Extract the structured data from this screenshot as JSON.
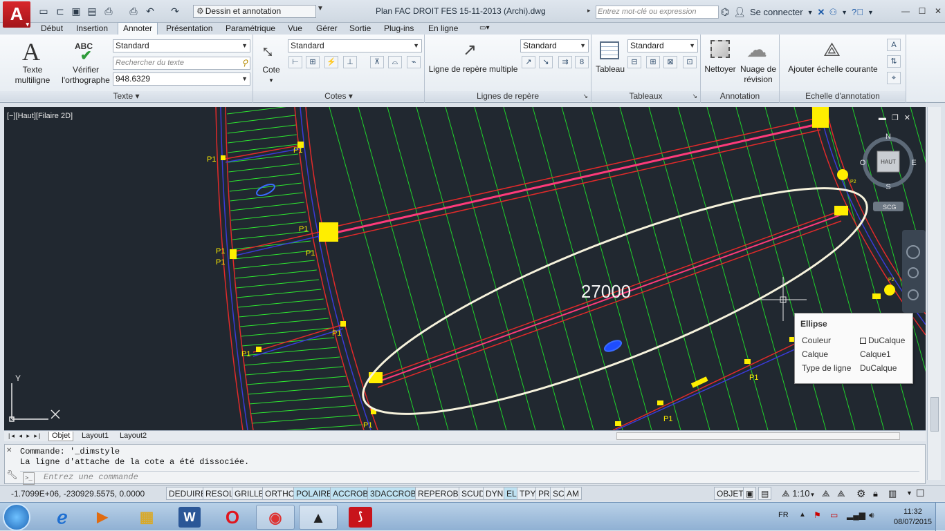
{
  "app": {
    "logo_letter": "A",
    "workspace": "Dessin et annotation",
    "document_title": "Plan FAC DROIT FES 15-11-2013 (Archi).dwg",
    "search_placeholder": "Entrez mot-clé ou expression",
    "sign_in": "Se connecter"
  },
  "tabs": [
    {
      "label": "Début"
    },
    {
      "label": "Insertion"
    },
    {
      "label": "Annoter",
      "active": true
    },
    {
      "label": "Présentation"
    },
    {
      "label": "Paramétrique"
    },
    {
      "label": "Vue"
    },
    {
      "label": "Gérer"
    },
    {
      "label": "Sortie"
    },
    {
      "label": "Plug-ins"
    },
    {
      "label": "En ligne"
    }
  ],
  "ribbon": {
    "texte": {
      "title": "Texte",
      "multiline_line1": "Texte",
      "multiline_line2": "multiligne",
      "spell_line1": "Vérifier",
      "spell_line2": "l'orthographe",
      "spell_icon_text": "ABC",
      "style_value": "Standard",
      "find_placeholder": "Rechercher du texte",
      "height_value": "948.6329"
    },
    "cotes": {
      "title": "Cotes",
      "button": "Cote",
      "style_value": "Standard"
    },
    "reperes": {
      "title": "Lignes de repère",
      "button": "Ligne de repère multiple",
      "style_value": "Standard"
    },
    "tableaux": {
      "title": "Tableaux",
      "button": "Tableau",
      "style_value": "Standard"
    },
    "annotation": {
      "title": "Annotation",
      "clean_button": "Nettoyer",
      "cloud_line1": "Nuage de",
      "cloud_line2": "révision"
    },
    "echelle": {
      "title": "Echelle d'annotation",
      "button": "Ajouter échelle courante"
    }
  },
  "viewport": {
    "label": "[−][Haut][Filaire 2D]",
    "dimension_text": "27000",
    "compass": {
      "n": "N",
      "s": "S",
      "e": "E",
      "w": "O",
      "center": "HAUT",
      "ucs": "SCG"
    },
    "marks": {
      "p1": "P1",
      "p2": "P2"
    },
    "axis": {
      "y": "Y"
    }
  },
  "tooltip": {
    "title": "Ellipse",
    "rows": [
      {
        "key": "Couleur",
        "value": "DuCalque"
      },
      {
        "key": "Calque",
        "value": "Calque1"
      },
      {
        "key": "Type de ligne",
        "value": "DuCalque"
      }
    ]
  },
  "layouts": [
    "Objet",
    "Layout1",
    "Layout2"
  ],
  "command": {
    "history": [
      "Commande: '_dimstyle",
      "La ligne d'attache de la cote a été dissociée."
    ],
    "placeholder": "Entrez une commande"
  },
  "status": {
    "coords": "-1.7099E+06, -230929.5575, 0.0000",
    "toggles": [
      {
        "label": "DEDUIRE",
        "on": false
      },
      {
        "label": "RESOL",
        "on": false
      },
      {
        "label": "GRILLE",
        "on": false
      },
      {
        "label": "ORTHO",
        "on": false
      },
      {
        "label": "POLAIRE",
        "on": true
      },
      {
        "label": "ACCROBJ",
        "on": true
      },
      {
        "label": "3DACCROBJ",
        "on": true
      },
      {
        "label": "REPEROBJ",
        "on": false
      },
      {
        "label": "SCUD",
        "on": false
      },
      {
        "label": "DYN",
        "on": false
      },
      {
        "label": "EL",
        "on": true
      },
      {
        "label": "TPY",
        "on": false
      },
      {
        "label": "PR",
        "on": false
      },
      {
        "label": "SC",
        "on": false
      },
      {
        "label": "AM",
        "on": false
      }
    ],
    "space": "OBJET",
    "scale": "1:10"
  },
  "taskbar": {
    "lang": "FR",
    "time": "11:32",
    "date": "08/07/2015",
    "word_letter": "W"
  }
}
